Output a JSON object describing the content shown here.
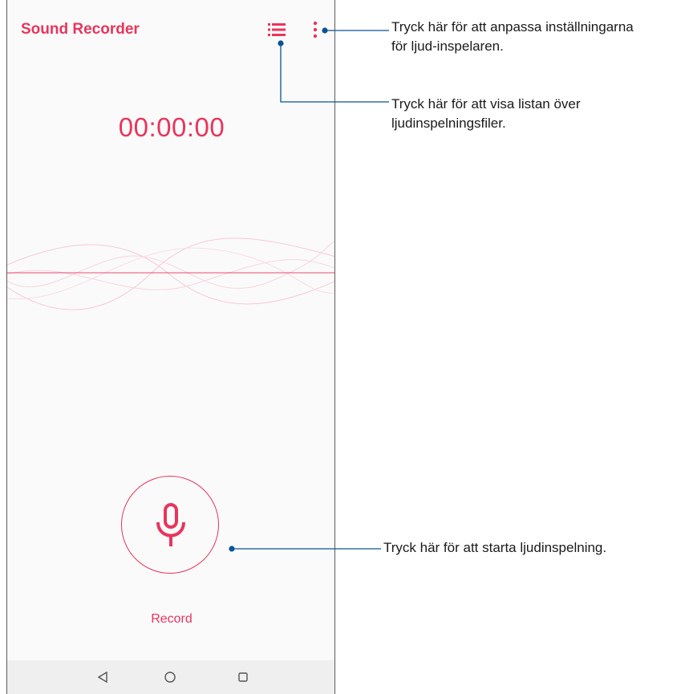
{
  "app": {
    "title": "Sound Recorder",
    "timer": "00:00:00",
    "record_label": "Record",
    "accent_color": "#e8355d"
  },
  "icons": {
    "list": "list-icon",
    "more": "more-vert-icon",
    "mic": "microphone-icon",
    "nav_back": "triangle-back-icon",
    "nav_home": "circle-home-icon",
    "nav_recent": "square-recent-icon"
  },
  "callouts": {
    "settings_line1": "Tryck här för att anpassa inställningarna",
    "settings_line2": "för ljud-inspelaren.",
    "list_line1": "Tryck här för att visa listan över",
    "list_line2": "ljudinspelningsfiler.",
    "record": "Tryck här för att starta ljudinspelning.",
    "line_color": "#0b5394"
  }
}
